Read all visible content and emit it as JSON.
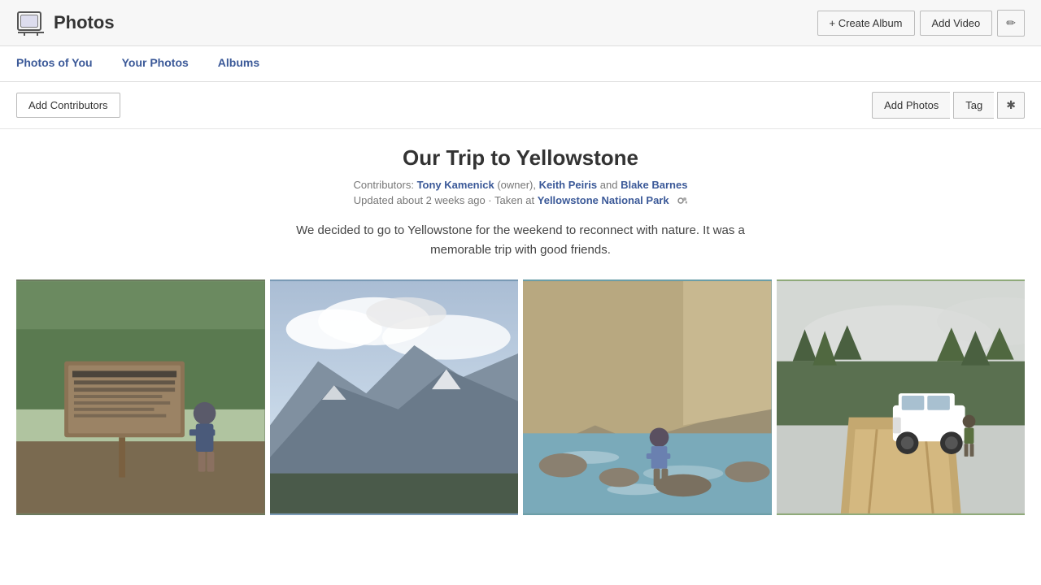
{
  "header": {
    "brand_title": "Photos",
    "actions": {
      "create_album": "+ Create Album",
      "add_video": "Add Video"
    }
  },
  "nav": {
    "tabs": [
      {
        "id": "photos-of-you",
        "label": "Photos of You"
      },
      {
        "id": "your-photos",
        "label": "Your Photos"
      },
      {
        "id": "albums",
        "label": "Albums"
      }
    ]
  },
  "toolbar": {
    "add_contributors_label": "Add Contributors",
    "add_photos_label": "Add Photos",
    "tag_label": "Tag"
  },
  "album": {
    "title": "Our Trip to Yellowstone",
    "contributors_prefix": "Contributors: ",
    "contributors": [
      {
        "name": "Tony Kamenick",
        "role": "owner"
      },
      {
        "name": "Keith Peiris",
        "role": "contributor"
      },
      {
        "name": "Blake Barnes",
        "role": "contributor"
      }
    ],
    "updated": "Updated about 2 weeks ago · Taken at",
    "location": "Yellowstone National Park",
    "description": "We decided to go to Yellowstone for the weekend to reconnect with nature. It was a memorable trip with good friends.",
    "photos": [
      {
        "id": "photo-1",
        "alt": "Man standing at Grand Canyon of the Yellowstone sign",
        "caption": "GRAND CANYON OF THE YELLOWSTONE"
      },
      {
        "id": "photo-2",
        "alt": "Mountain landscape with cloudy sky",
        "caption": ""
      },
      {
        "id": "photo-3",
        "alt": "Man walking on rocks by a river",
        "caption": ""
      },
      {
        "id": "photo-4",
        "alt": "White Jeep on a dirt road with forest background",
        "caption": ""
      }
    ]
  }
}
